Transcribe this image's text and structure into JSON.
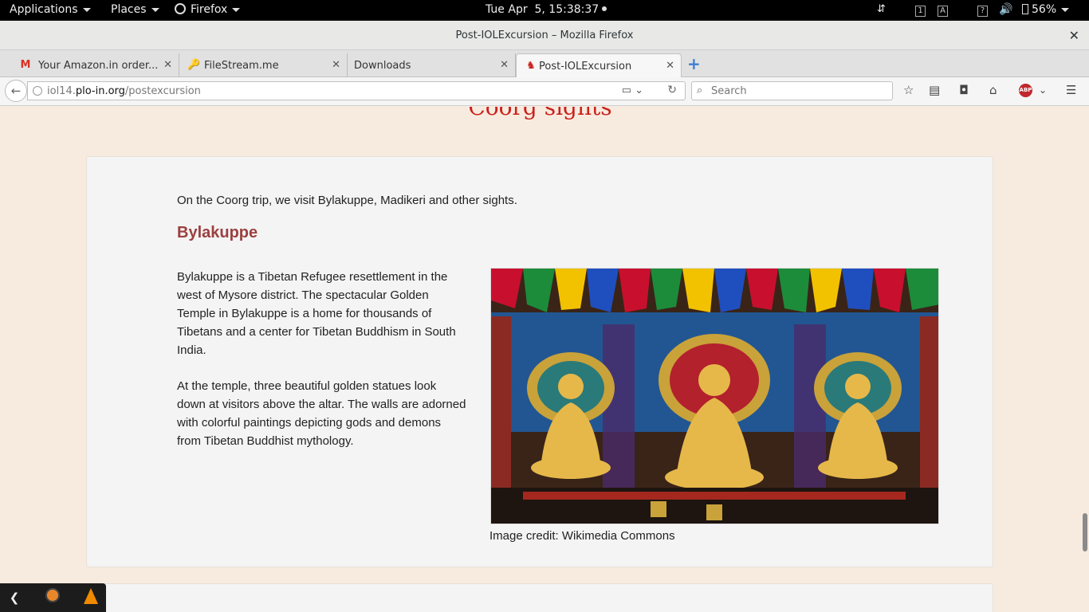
{
  "topbar": {
    "applications": "Applications",
    "places": "Places",
    "firefox": "Firefox",
    "clock": "Tue Apr  5, 15:38:37",
    "ws1": "1",
    "ws2": "A",
    "battery": "56%"
  },
  "window": {
    "title": "Post-IOLExcursion – Mozilla Firefox"
  },
  "tabs": [
    {
      "label": "Your Amazon.in order...",
      "favicon": "gmail-icon"
    },
    {
      "label": "FileStream.me",
      "favicon": "filestream-icon"
    },
    {
      "label": "Downloads",
      "favicon": ""
    },
    {
      "label": "Post-IOLExcursion",
      "favicon": "iol-icon"
    }
  ],
  "nav": {
    "url_prefix": "iol14.",
    "url_domain": "plo-in.org",
    "url_path": "/postexcursion",
    "search_placeholder": "Search",
    "abp": "ABP"
  },
  "page": {
    "section_heading": "Coorg sights",
    "intro": "On the Coorg trip, we visit Bylakuppe, Madikeri and other sights.",
    "subheading": "Bylakuppe",
    "para1": "Bylakuppe is a Tibetan Refugee resettlement in the west of Mysore district. The spectacular Golden Temple in Bylakuppe is a home for thousands of Tibetans and a center for Tibetan Buddhism in South India.",
    "para2": "At the temple, three beautiful golden statues look down at visitors above the altar. The walls are adorned with colorful paintings depicting gods and demons from Tibetan Buddhist mythology.",
    "image_credit": "Image credit: Wikimedia Commons"
  },
  "colors": {
    "heading_red": "#cc1f1a",
    "subheading": "#9c4040",
    "page_bg": "#f7ebdf",
    "card_bg": "#f4f4f4"
  }
}
